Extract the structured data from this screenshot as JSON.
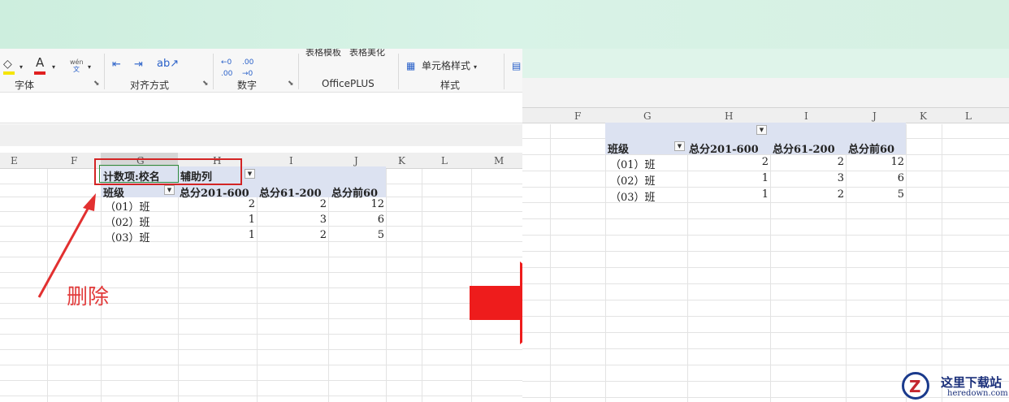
{
  "ribbon": {
    "groups": [
      "字体",
      "对齐方式",
      "数字",
      "OfficePLUS",
      "样式"
    ],
    "buttons": {
      "fill_color": "◇",
      "font_color": "A",
      "phonetic": "wén",
      "phonetic_sub": "文",
      "template": "表格模板",
      "beautify": "表格美化",
      "cell_style": "单元格样式"
    }
  },
  "left_sheet": {
    "columns": [
      "E",
      "F",
      "G",
      "H",
      "I",
      "J",
      "K",
      "L",
      "M"
    ],
    "pivot": {
      "count_field": "计数项:校名",
      "aux_field": "辅助列",
      "row_header": "班级",
      "col_headers": [
        "总分201-600",
        "总分61-200",
        "总分前60"
      ],
      "rows": [
        {
          "label": "（01）班",
          "values": [
            "2",
            "2",
            "12"
          ]
        },
        {
          "label": "（02）班",
          "values": [
            "1",
            "3",
            "6"
          ]
        },
        {
          "label": "（03）班",
          "values": [
            "1",
            "2",
            "5"
          ]
        }
      ]
    },
    "annotation": "删除"
  },
  "right_sheet": {
    "columns": [
      "F",
      "G",
      "H",
      "I",
      "J",
      "K",
      "L"
    ],
    "pivot": {
      "row_header": "班级",
      "col_headers": [
        "总分201-600",
        "总分61-200",
        "总分前60"
      ],
      "rows": [
        {
          "label": "（01）班",
          "values": [
            "2",
            "2",
            "12"
          ]
        },
        {
          "label": "（02）班",
          "values": [
            "1",
            "3",
            "6"
          ]
        },
        {
          "label": "（03）班",
          "values": [
            "1",
            "2",
            "5"
          ]
        }
      ]
    }
  },
  "watermark": {
    "logo_letter": "Z",
    "title": "这里下载站",
    "subtitle": "heredown.com"
  },
  "colors": {
    "arrow": "#ee1c1c",
    "annotation": "#e23b3b",
    "highlight_box": "#d32424",
    "pivot_band": "#dce2f1"
  }
}
